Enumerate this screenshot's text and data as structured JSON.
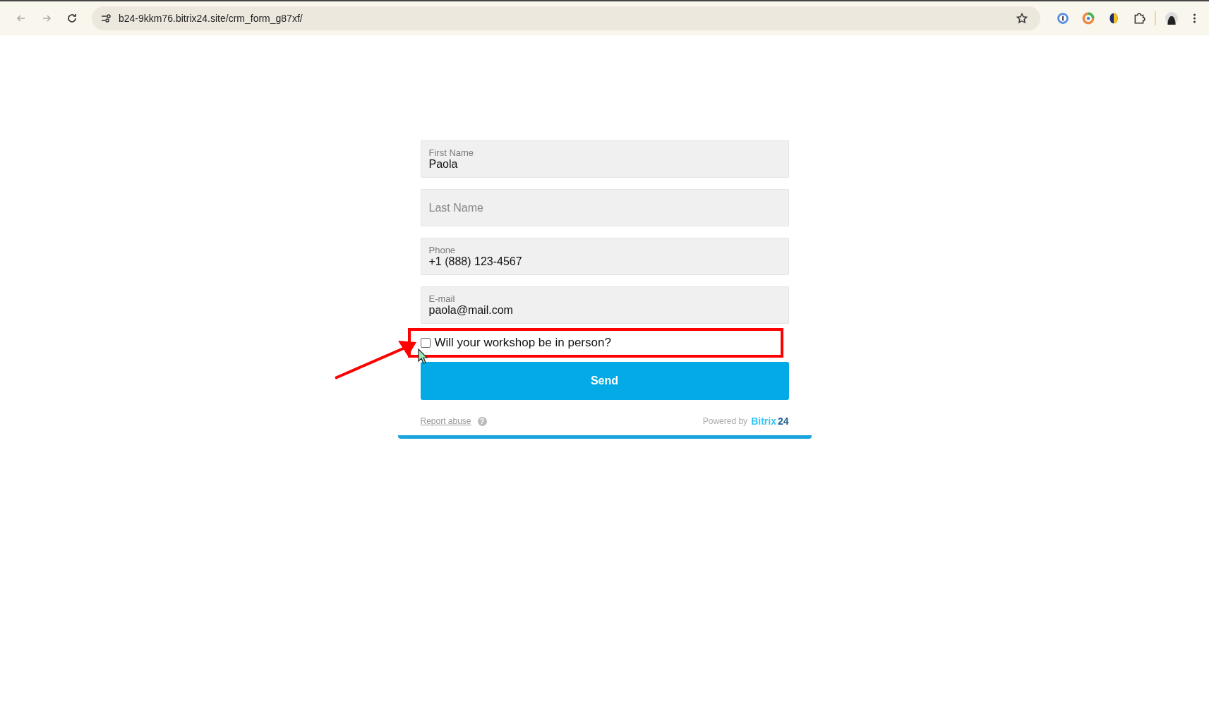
{
  "browser": {
    "url": "b24-9kkm76.bitrix24.site/crm_form_g87xf/"
  },
  "form": {
    "fields": [
      {
        "label": "First Name",
        "value": "Paola"
      },
      {
        "placeholder": "Last Name"
      },
      {
        "label": "Phone",
        "value": "+1 (888) 123-4567"
      },
      {
        "label": "E-mail",
        "value": "paola@mail.com"
      }
    ],
    "checkbox": {
      "label": "Will your workshop be in person?",
      "checked": false
    },
    "submit": "Send",
    "report_abuse": "Report abuse",
    "help": "?",
    "powered_by": "Powered by",
    "brand": "Bitrix",
    "brand_number": "24"
  }
}
